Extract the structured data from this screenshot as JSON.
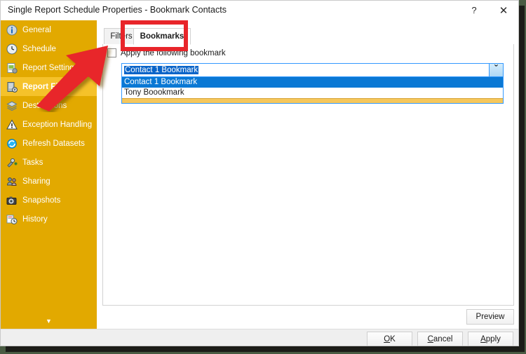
{
  "window": {
    "title": "Single Report Schedule Properties - Bookmark Contacts",
    "help_label": "?",
    "close_label": "✕"
  },
  "sidebar": {
    "expander_label": "▼",
    "items": [
      {
        "label": "General",
        "icon": "info-icon",
        "selected": false
      },
      {
        "label": "Schedule",
        "icon": "clock-icon",
        "selected": false
      },
      {
        "label": "Report Settings",
        "icon": "report-settings-icon",
        "selected": false
      },
      {
        "label": "Report Filters",
        "icon": "report-filters-icon",
        "selected": true
      },
      {
        "label": "Destinations",
        "icon": "destinations-icon",
        "selected": false
      },
      {
        "label": "Exception Handling",
        "icon": "warning-triangle-icon",
        "selected": false
      },
      {
        "label": "Refresh Datasets",
        "icon": "refresh-datasets-icon",
        "selected": false
      },
      {
        "label": "Tasks",
        "icon": "tasks-icon",
        "selected": false
      },
      {
        "label": "Sharing",
        "icon": "sharing-icon",
        "selected": false
      },
      {
        "label": "Snapshots",
        "icon": "camera-icon",
        "selected": false
      },
      {
        "label": "History",
        "icon": "history-icon",
        "selected": false
      }
    ]
  },
  "tabs": [
    {
      "label": "Filters",
      "active": false
    },
    {
      "label": "Bookmarks",
      "active": true
    }
  ],
  "panel": {
    "apply_checkbox_label": "Apply the following bookmark",
    "apply_checkbox_checked": false,
    "combobox": {
      "value": "Contact 1 Bookmark",
      "expanded": true,
      "arrow_glyph": "ˇ",
      "options": [
        {
          "label": "Contact 1 Bookmark",
          "highlighted": true
        },
        {
          "label": "Tony Boookmark",
          "highlighted": false
        }
      ]
    },
    "preview_label": "Preview"
  },
  "footer": {
    "ok_label": "OK",
    "ok_mnemonic": "O",
    "cancel_label": "Cancel",
    "cancel_mnemonic": "C",
    "apply_label": "Apply",
    "apply_mnemonic": "A"
  },
  "annotations": {
    "highlight_box_target": "Bookmarks tab",
    "arrow_color": "#e8252a",
    "box_color": "#e8252a"
  },
  "colors": {
    "sidebar_bg": "#e2a900",
    "sidebar_selected_bg": "#f5c22a",
    "selection_blue": "#0a78d4",
    "desktop_bg": "#4a5b43",
    "dropdown_footer": "#f6c75b"
  }
}
